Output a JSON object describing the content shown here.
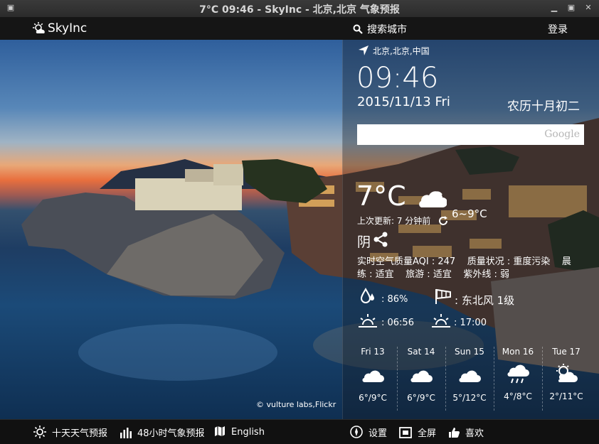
{
  "window": {
    "title": "7°C 09:46 - SkyInc - 北京,北京 气象预报"
  },
  "nav": {
    "brand": "SkyInc",
    "search_label": "搜索城市",
    "login_label": "登录"
  },
  "photo": {
    "credit": "© vulture labs,Flickr"
  },
  "location": {
    "text": "北京,北京,中国"
  },
  "clock": {
    "time": "09:46",
    "date": "2015/11/13 Fri",
    "lunar": "农历十月初二"
  },
  "google": {
    "placeholder": "Google"
  },
  "current": {
    "temp": "7°C",
    "updated": "上次更新: 7 分钟前",
    "range": "6~9°C",
    "condition": "阴",
    "aqi_line": "实时空气质量AQI : 247    质量状况 : 重度污染    晨",
    "index_line": "练 : 适宜    旅游 : 适宜    紫外线 : 弱",
    "humidity": ": 86%",
    "wind": ": 东北风 1级",
    "sunrise": ": 06:56",
    "sunset": ": 17:00"
  },
  "forecast": [
    {
      "day": "Fri 13",
      "temp": "6°/9°C",
      "icon": "cloudy-icon"
    },
    {
      "day": "Sat 14",
      "temp": "6°/9°C",
      "icon": "cloudy-icon"
    },
    {
      "day": "Sun 15",
      "temp": "5°/12°C",
      "icon": "cloudy-icon"
    },
    {
      "day": "Mon 16",
      "temp": "4°/8°C",
      "icon": "rain-icon"
    },
    {
      "day": "Tue 17",
      "temp": "2°/11°C",
      "icon": "partly-cloudy-icon"
    }
  ],
  "bottom": {
    "ten_day": "十天天气预报",
    "hours48": "48小时气象预报",
    "english": "English",
    "settings": "设置",
    "fullscreen": "全屏",
    "like": "喜欢"
  }
}
